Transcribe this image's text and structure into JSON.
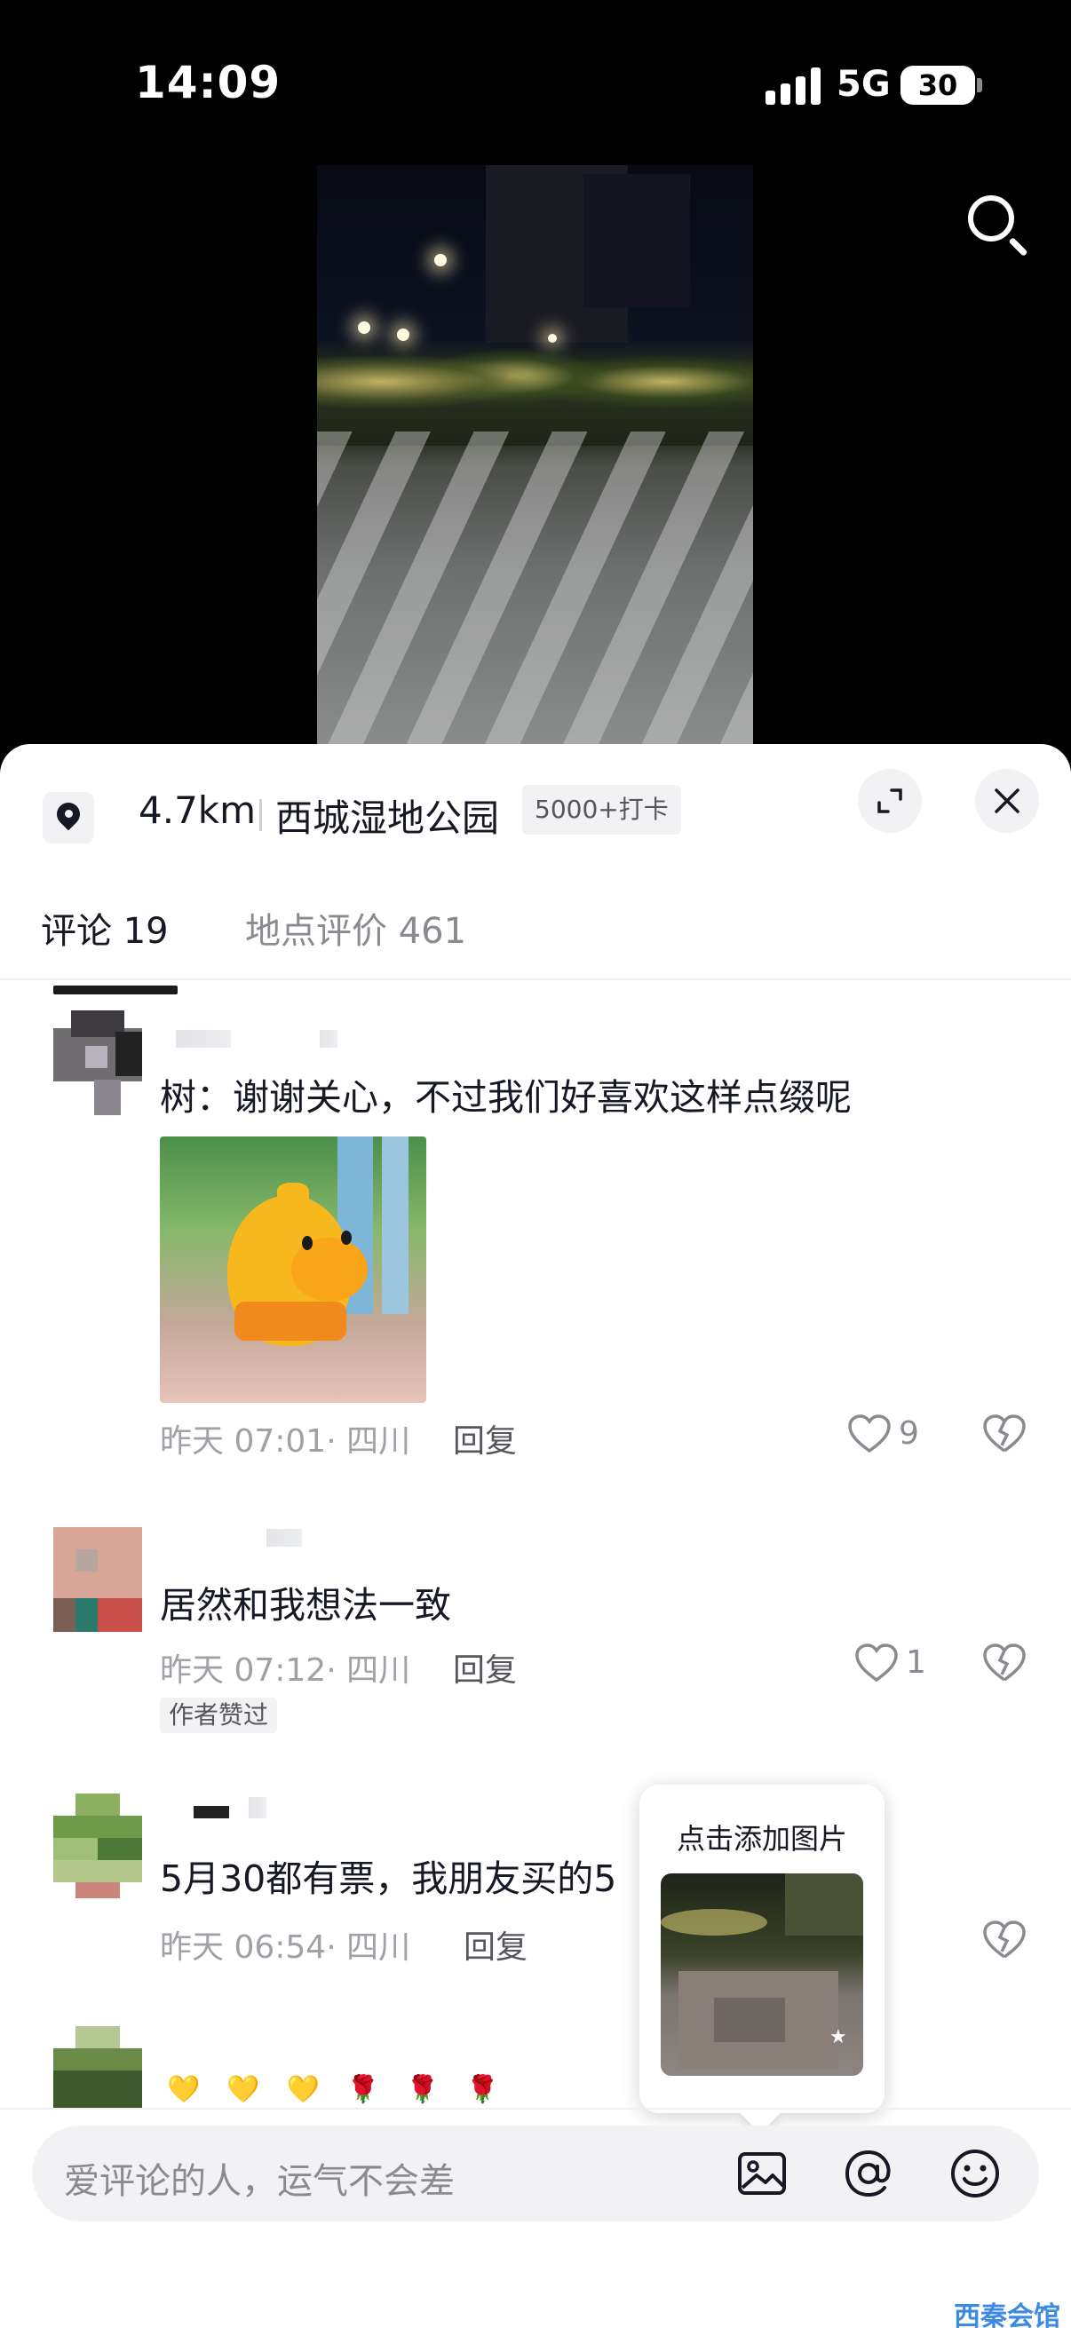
{
  "status_bar": {
    "time": "14:09",
    "network": "5G",
    "battery": "30"
  },
  "location": {
    "distance": "4.7km",
    "name": "西城湿地公园",
    "checkin": "5000+打卡"
  },
  "tabs": [
    {
      "label": "评论 19"
    },
    {
      "label": "地点评价 461"
    }
  ],
  "comments": [
    {
      "text": "树：谢谢关心，不过我们好喜欢这样点缀呢",
      "meta": "昨天 07:01· 四川",
      "reply": "回复",
      "likes": "9"
    },
    {
      "text": "居然和我想法一致",
      "meta": "昨天 07:12· 四川",
      "reply": "回复",
      "likes": "1",
      "badge": "作者赞过"
    },
    {
      "text": "5月30都有票，我朋友买的5",
      "meta": "昨天 06:54· 四川",
      "reply": "回复"
    },
    {
      "emojis": "💛💛💛🌹🌹🌹"
    }
  ],
  "popup": {
    "label": "点击添加图片"
  },
  "input": {
    "placeholder": "爱评论的人，运气不会差"
  },
  "watermark": "西秦会馆"
}
